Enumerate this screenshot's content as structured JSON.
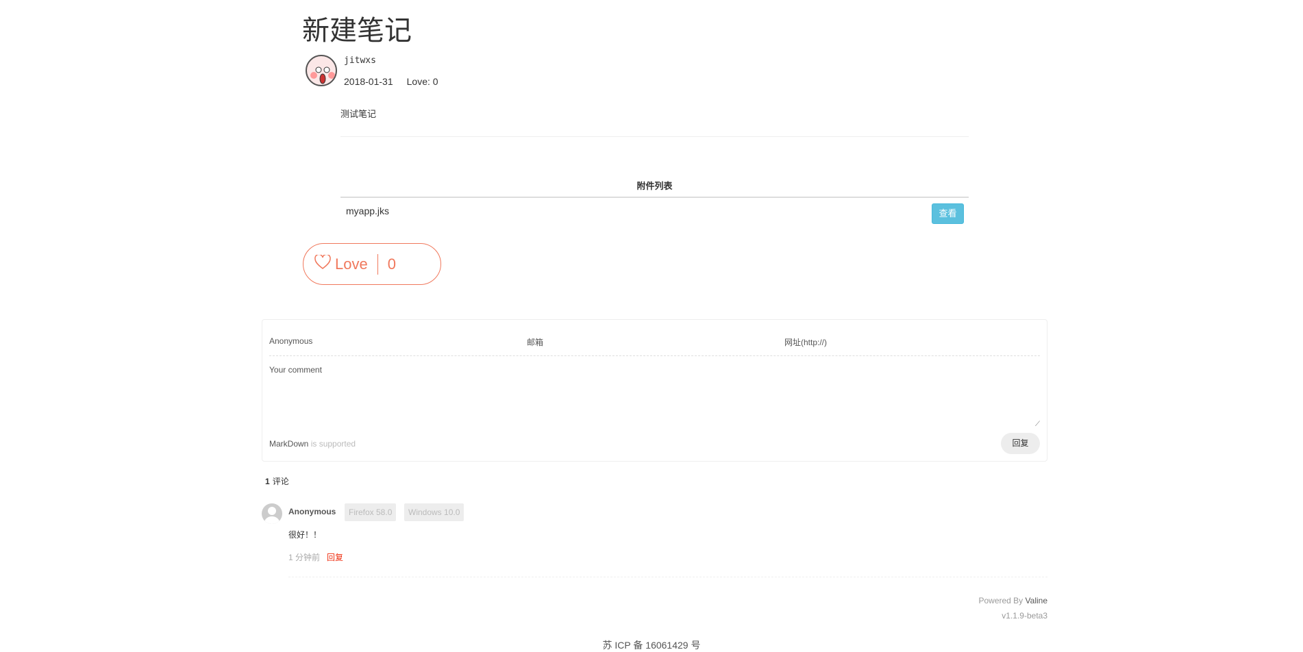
{
  "note": {
    "title": "新建笔记",
    "author": "jitwxs",
    "date": "2018-01-31",
    "love_meta": "Love: 0",
    "content": "测试笔记"
  },
  "attachments": {
    "title": "附件列表",
    "items": [
      {
        "name": "myapp.jks",
        "action": "查看"
      }
    ]
  },
  "love_button": {
    "label": "Love",
    "count": "0"
  },
  "comment_form": {
    "nick_placeholder": "Anonymous",
    "mail_placeholder": "邮箱",
    "link_placeholder": "网址(http://)",
    "comment_placeholder": "Your comment",
    "markdown": "MarkDown",
    "markdown_suffix": " is supported",
    "submit": "回复"
  },
  "comments": {
    "count": "1",
    "count_label": "评论",
    "items": [
      {
        "name": "Anonymous",
        "browser": "Firefox 58.0",
        "os": "Windows 10.0",
        "text": "很好！！",
        "time": "1 分钟前",
        "reply": "回复"
      }
    ]
  },
  "footer": {
    "powered": "Powered By ",
    "valine": "Valine",
    "version": "v1.1.9-beta3",
    "icp": "苏 ICP 备 16061429 号"
  },
  "colors": {
    "love": "#f0785c",
    "view_button": "#5bc0de",
    "reply_link": "#ef2f11"
  }
}
